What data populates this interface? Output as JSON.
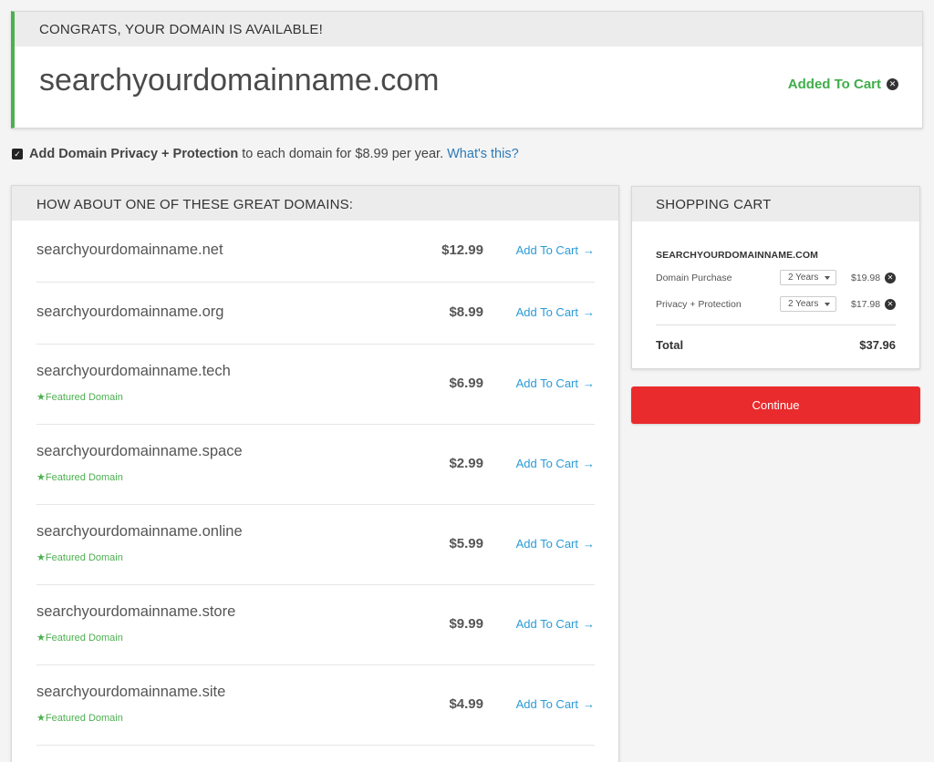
{
  "available": {
    "header": "CONGRATS, YOUR DOMAIN IS AVAILABLE!",
    "domain": "searchyourdomainname.com",
    "status": "Added To Cart",
    "accent_color": "#4caf50"
  },
  "privacy": {
    "checked": true,
    "bold": "Add Domain Privacy + Protection",
    "text": "to each domain for $8.99 per year.",
    "link": "What's this?"
  },
  "suggestions": {
    "header": "HOW ABOUT ONE OF THESE GREAT DOMAINS:",
    "add_label": "Add To Cart",
    "featured_label": "Featured Domain",
    "items": [
      {
        "name": "searchyourdomainname.net",
        "price": "$12.99",
        "featured": false
      },
      {
        "name": "searchyourdomainname.org",
        "price": "$8.99",
        "featured": false
      },
      {
        "name": "searchyourdomainname.tech",
        "price": "$6.99",
        "featured": true
      },
      {
        "name": "searchyourdomainname.space",
        "price": "$2.99",
        "featured": true
      },
      {
        "name": "searchyourdomainname.online",
        "price": "$5.99",
        "featured": true
      },
      {
        "name": "searchyourdomainname.store",
        "price": "$9.99",
        "featured": true
      },
      {
        "name": "searchyourdomainname.site",
        "price": "$4.99",
        "featured": true
      }
    ]
  },
  "cart": {
    "header": "SHOPPING CART",
    "domain": "SEARCHYOURDOMAINNAME.COM",
    "lines": [
      {
        "label": "Domain Purchase",
        "term": "2 Years",
        "amount": "$19.98"
      },
      {
        "label": "Privacy + Protection",
        "term": "2 Years",
        "amount": "$17.98"
      }
    ],
    "total_label": "Total",
    "total_value": "$37.96"
  },
  "continue_label": "Continue",
  "continue_color": "#e92b2d"
}
